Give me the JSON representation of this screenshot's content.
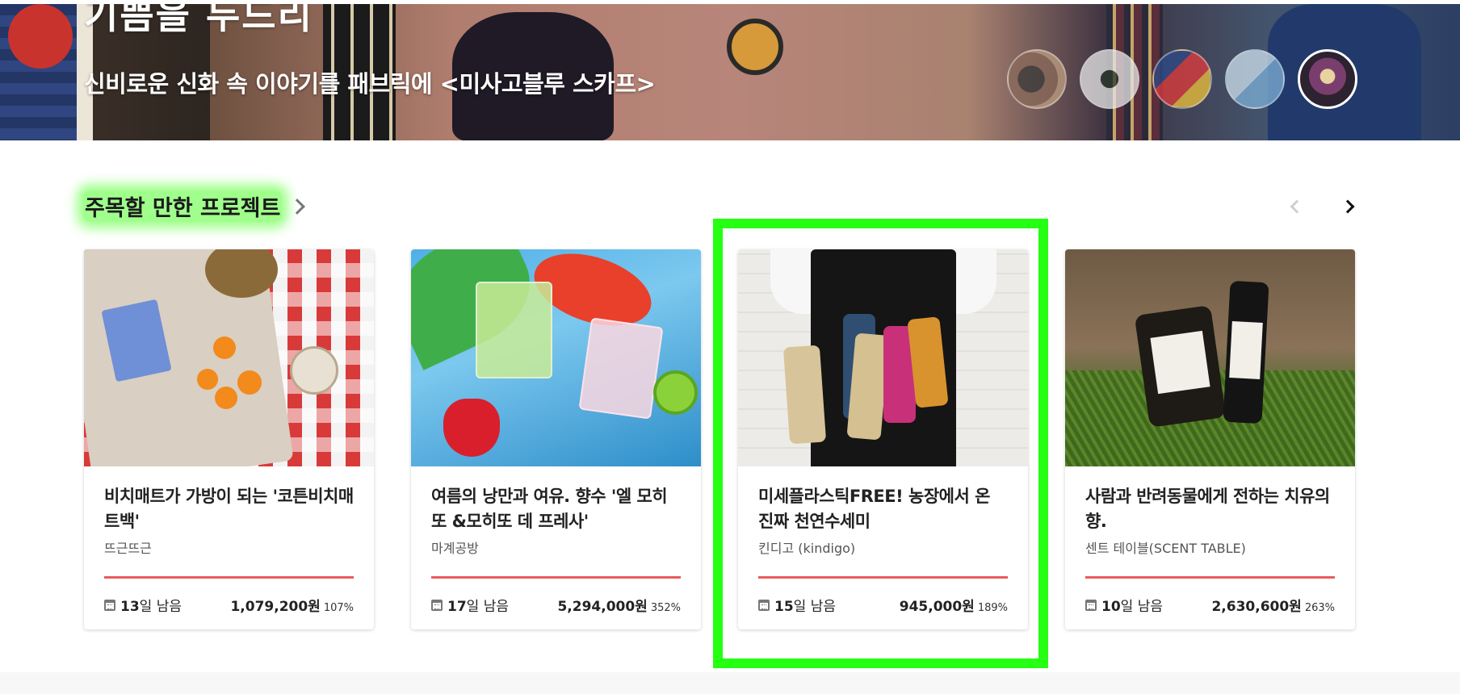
{
  "hero": {
    "title_partial": "기쁨을 두드리",
    "subtitle": "신비로운 신화 속 이야기를 패브릭에 <미사고블루 스카프>"
  },
  "section": {
    "title": "주목할 만한 프로젝트"
  },
  "cards": [
    {
      "title": "비치매트가 가방이 되는 '코튼비치매트백'",
      "maker": "뜨근뜨근",
      "days": "13",
      "days_suffix": "일 남음",
      "amount": "1,079,200원",
      "percent": "107%",
      "progress": 1.0
    },
    {
      "title": "여름의 낭만과 여유. 향수 '엘 모히또 &모히또 데 프레사'",
      "maker": "마계공방",
      "days": "17",
      "days_suffix": "일 남음",
      "amount": "5,294,000원",
      "percent": "352%",
      "progress": 1.0
    },
    {
      "title": "미세플라스틱FREE! 농장에서 온 진짜 천연수세미",
      "maker": "킨디고 (kindigo)",
      "days": "15",
      "days_suffix": "일 남음",
      "amount": "945,000원",
      "percent": "189%",
      "progress": 1.0
    },
    {
      "title": "사람과 반려동물에게 전하는 치유의 향.",
      "maker": "센트 테이블(SCENT TABLE)",
      "days": "10",
      "days_suffix": "일 남음",
      "amount": "2,630,600원",
      "percent": "263%",
      "progress": 1.0
    }
  ],
  "colors": {
    "accent_red": "#e85c5c",
    "highlight_green": "#24ff12"
  },
  "icons": {
    "section_more": "chevron-right-icon",
    "prev": "chevron-left-icon",
    "next": "chevron-right-icon",
    "days": "calendar-icon"
  }
}
